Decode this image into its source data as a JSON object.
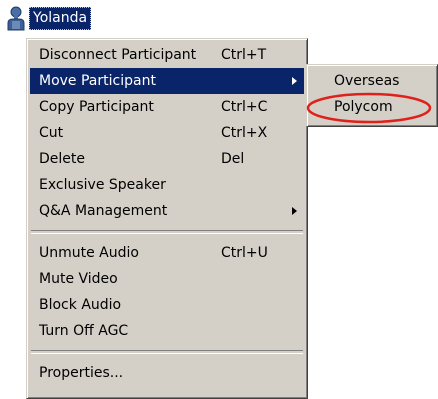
{
  "participant": {
    "name": "Yolanda",
    "icon": "user-icon"
  },
  "menu": {
    "items": [
      {
        "label": "Disconnect Participant",
        "shortcut": "Ctrl+T"
      },
      {
        "label": "Move Participant",
        "shortcut": "",
        "submenu": true,
        "highlighted": true
      },
      {
        "label": "Copy Participant",
        "shortcut": "Ctrl+C"
      },
      {
        "label": "Cut",
        "shortcut": "Ctrl+X"
      },
      {
        "label": "Delete",
        "shortcut": "Del"
      },
      {
        "label": "Exclusive Speaker",
        "shortcut": ""
      },
      {
        "label": "Q&A Management",
        "shortcut": "",
        "submenu": true
      },
      {
        "label": "Unmute Audio",
        "shortcut": "Ctrl+U"
      },
      {
        "label": "Mute Video",
        "shortcut": ""
      },
      {
        "label": "Block Audio",
        "shortcut": ""
      },
      {
        "label": "Turn Off AGC",
        "shortcut": ""
      },
      {
        "label": "Properties...",
        "shortcut": ""
      }
    ]
  },
  "submenu": {
    "items": [
      {
        "label": "Overseas"
      },
      {
        "label": "Polycom",
        "annotated": true
      }
    ]
  },
  "colors": {
    "menu_background": "#d4d0c8",
    "highlight": "#0a246a",
    "annotation": "#e0201a"
  }
}
